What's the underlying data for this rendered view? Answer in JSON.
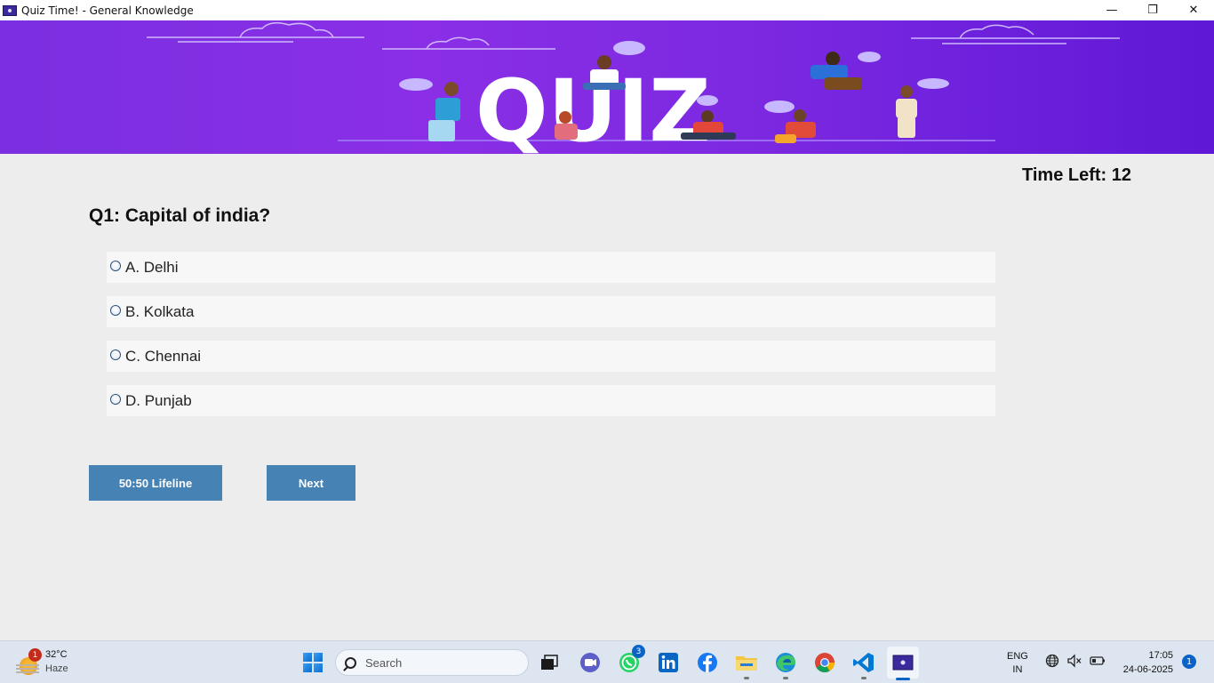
{
  "window": {
    "title": "Quiz Time! - General Knowledge",
    "minimize_glyph": "—",
    "maximize_glyph": "❐",
    "close_glyph": "✕"
  },
  "banner": {
    "word": "QUIZ"
  },
  "quiz": {
    "timer_label": "Time Left: 12",
    "question": "Q1: Capital of india?",
    "options": [
      {
        "label": "A. Delhi"
      },
      {
        "label": "B. Kolkata"
      },
      {
        "label": "C. Chennai"
      },
      {
        "label": "D. Punjab"
      }
    ],
    "lifeline_label": "50:50 Lifeline",
    "next_label": "Next",
    "button_color": "#4682b4"
  },
  "taskbar": {
    "weather_badge": "1",
    "weather_temp": "32°C",
    "weather_cond": "Haze",
    "search_label": "Search",
    "whatsapp_badge": "3",
    "lang_line1": "ENG",
    "lang_line2": "IN",
    "time": "17:05",
    "date": "24-06-2025",
    "notification_count": "1",
    "icons": [
      "windows-start-icon",
      "search-icon",
      "task-view-icon",
      "teams-icon",
      "whatsapp-icon",
      "linkedin-icon",
      "facebook-icon",
      "file-explorer-icon",
      "edge-icon",
      "chrome-icon",
      "vscode-icon",
      "quiz-app-icon",
      "network-icon",
      "volume-muted-icon",
      "battery-icon"
    ]
  }
}
